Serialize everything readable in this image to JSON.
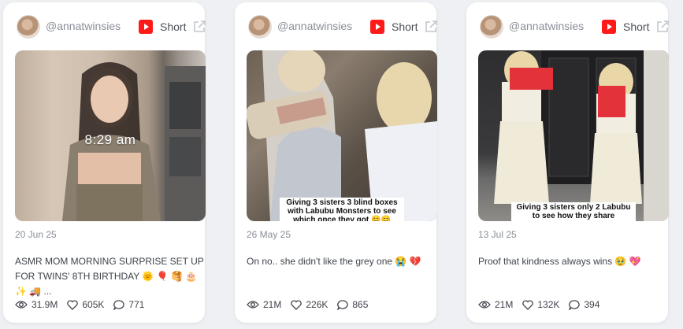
{
  "cards": [
    {
      "handle": "@annatwinsies",
      "platform_label": "Short",
      "thumb_overlay": "8:29 am",
      "date": "20 Jun 25",
      "caption": "ASMR MOM MORNING SURPRISE SET UP FOR TWINS' 8TH BIRTHDAY 🌞 🎈 🥞 🎂 ✨ 🚚 ...",
      "views": "31.9M",
      "likes": "605K",
      "comments": "771"
    },
    {
      "handle": "@annatwinsies",
      "platform_label": "Short",
      "thumb_overlay": "Giving 3 sisters 3 blind boxes with Labubu Monsters to see which once they got 😊😊",
      "date": "26 May 25",
      "caption": "On no.. she didn't like the grey one 😭 💔",
      "views": "21M",
      "likes": "226K",
      "comments": "865"
    },
    {
      "handle": "@annatwinsies",
      "platform_label": "Short",
      "thumb_overlay": "Giving 3 sisters only 2 Labubu to see how they share",
      "date": "13 Jul 25",
      "caption": "Proof that kindness always wins 🥹 💖",
      "views": "21M",
      "likes": "132K",
      "comments": "394"
    }
  ],
  "colors": {
    "youtube_red": "#ff1a1a",
    "card_bg": "#ffffff",
    "page_bg": "#eef0f3"
  },
  "icons": [
    "avatar",
    "youtube-icon",
    "external-link-icon",
    "eye-icon",
    "heart-icon",
    "comment-icon"
  ]
}
